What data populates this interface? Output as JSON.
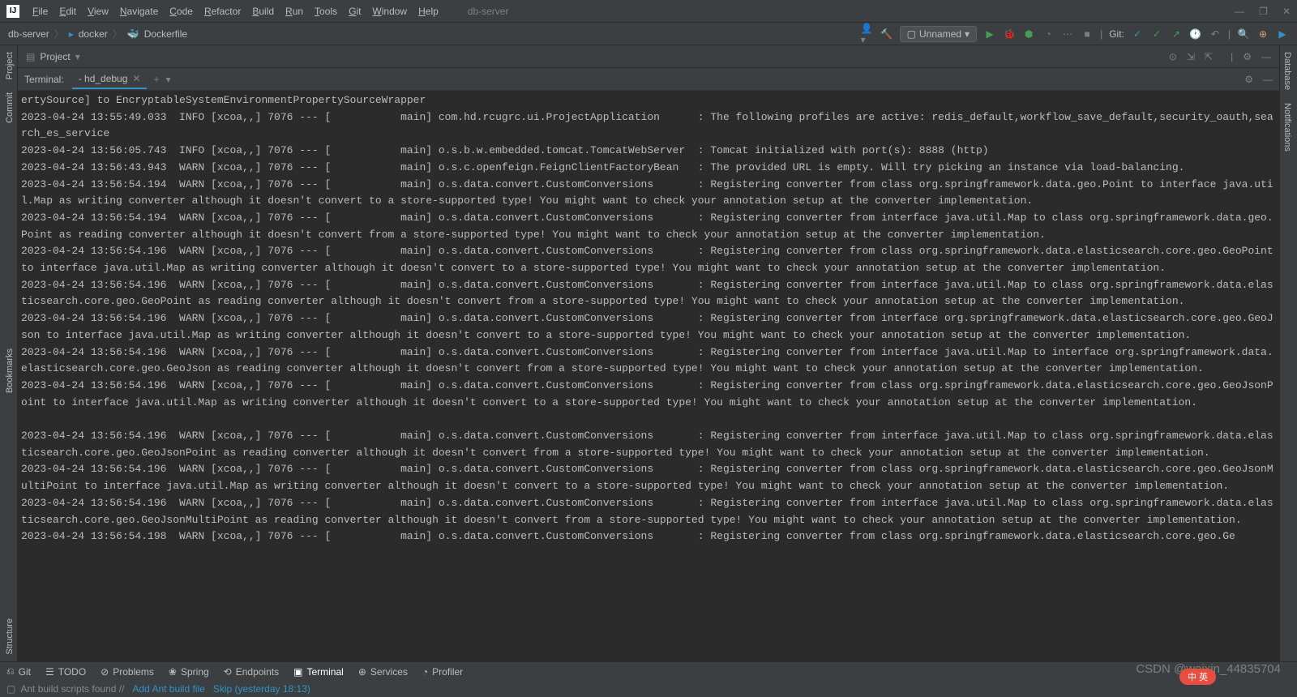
{
  "title_bar": {
    "project": "db-server"
  },
  "menus": [
    "File",
    "Edit",
    "View",
    "Navigate",
    "Code",
    "Refactor",
    "Build",
    "Run",
    "Tools",
    "Git",
    "Window",
    "Help"
  ],
  "breadcrumb": {
    "root": "db-server",
    "mid": "docker",
    "file": "Dockerfile"
  },
  "run_config": {
    "label": "Unnamed"
  },
  "git_label": "Git:",
  "project_panel": {
    "label": "Project"
  },
  "left_tabs": [
    "Project",
    "Commit",
    "Bookmarks",
    "Structure"
  ],
  "right_tabs": [
    "Database",
    "Notifications"
  ],
  "terminal": {
    "label": "Terminal:",
    "tab": "- hd_debug",
    "lines": [
      "ertySource] to EncryptableSystemEnvironmentPropertySourceWrapper",
      "2023-04-24 13:55:49.033  INFO [xcoa,,] 7076 --- [           main] com.hd.rcugrc.ui.ProjectApplication      : The following profiles are active: redis_default,workflow_save_default,security_oauth,search_es_service",
      "2023-04-24 13:56:05.743  INFO [xcoa,,] 7076 --- [           main] o.s.b.w.embedded.tomcat.TomcatWebServer  : Tomcat initialized with port(s): 8888 (http)",
      "2023-04-24 13:56:43.943  WARN [xcoa,,] 7076 --- [           main] o.s.c.openfeign.FeignClientFactoryBean   : The provided URL is empty. Will try picking an instance via load-balancing.",
      "2023-04-24 13:56:54.194  WARN [xcoa,,] 7076 --- [           main] o.s.data.convert.CustomConversions       : Registering converter from class org.springframework.data.geo.Point to interface java.util.Map as writing converter although it doesn't convert to a store-supported type! You might want to check your annotation setup at the converter implementation.",
      "2023-04-24 13:56:54.194  WARN [xcoa,,] 7076 --- [           main] o.s.data.convert.CustomConversions       : Registering converter from interface java.util.Map to class org.springframework.data.geo.Point as reading converter although it doesn't convert from a store-supported type! You might want to check your annotation setup at the converter implementation.",
      "2023-04-24 13:56:54.196  WARN [xcoa,,] 7076 --- [           main] o.s.data.convert.CustomConversions       : Registering converter from class org.springframework.data.elasticsearch.core.geo.GeoPoint to interface java.util.Map as writing converter although it doesn't convert to a store-supported type! You might want to check your annotation setup at the converter implementation.",
      "2023-04-24 13:56:54.196  WARN [xcoa,,] 7076 --- [           main] o.s.data.convert.CustomConversions       : Registering converter from interface java.util.Map to class org.springframework.data.elasticsearch.core.geo.GeoPoint as reading converter although it doesn't convert from a store-supported type! You might want to check your annotation setup at the converter implementation.",
      "2023-04-24 13:56:54.196  WARN [xcoa,,] 7076 --- [           main] o.s.data.convert.CustomConversions       : Registering converter from interface org.springframework.data.elasticsearch.core.geo.GeoJson to interface java.util.Map as writing converter although it doesn't convert to a store-supported type! You might want to check your annotation setup at the converter implementation.",
      "2023-04-24 13:56:54.196  WARN [xcoa,,] 7076 --- [           main] o.s.data.convert.CustomConversions       : Registering converter from interface java.util.Map to interface org.springframework.data.elasticsearch.core.geo.GeoJson as reading converter although it doesn't convert from a store-supported type! You might want to check your annotation setup at the converter implementation.",
      "2023-04-24 13:56:54.196  WARN [xcoa,,] 7076 --- [           main] o.s.data.convert.CustomConversions       : Registering converter from class org.springframework.data.elasticsearch.core.geo.GeoJsonPoint to interface java.util.Map as writing converter although it doesn't convert to a store-supported type! You might want to check your annotation setup at the converter implementation.",
      "",
      "2023-04-24 13:56:54.196  WARN [xcoa,,] 7076 --- [           main] o.s.data.convert.CustomConversions       : Registering converter from interface java.util.Map to class org.springframework.data.elasticsearch.core.geo.GeoJsonPoint as reading converter although it doesn't convert from a store-supported type! You might want to check your annotation setup at the converter implementation.",
      "2023-04-24 13:56:54.196  WARN [xcoa,,] 7076 --- [           main] o.s.data.convert.CustomConversions       : Registering converter from class org.springframework.data.elasticsearch.core.geo.GeoJsonMultiPoint to interface java.util.Map as writing converter although it doesn't convert to a store-supported type! You might want to check your annotation setup at the converter implementation.",
      "2023-04-24 13:56:54.196  WARN [xcoa,,] 7076 --- [           main] o.s.data.convert.CustomConversions       : Registering converter from interface java.util.Map to class org.springframework.data.elasticsearch.core.geo.GeoJsonMultiPoint as reading converter although it doesn't convert from a store-supported type! You might want to check your annotation setup at the converter implementation.",
      "2023-04-24 13:56:54.198  WARN [xcoa,,] 7076 --- [           main] o.s.data.convert.CustomConversions       : Registering converter from class org.springframework.data.elasticsearch.core.geo.Ge"
    ]
  },
  "bottom_tabs": [
    {
      "icon": "⎌",
      "label": "Git"
    },
    {
      "icon": "☰",
      "label": "TODO"
    },
    {
      "icon": "⊘",
      "label": "Problems"
    },
    {
      "icon": "❀",
      "label": "Spring"
    },
    {
      "icon": "⟲",
      "label": "Endpoints"
    },
    {
      "icon": "▣",
      "label": "Terminal"
    },
    {
      "icon": "⊕",
      "label": "Services"
    },
    {
      "icon": "◔",
      "label": "Profiler"
    }
  ],
  "status": {
    "msg": "Ant build scripts found //",
    "link1": "Add Ant build file",
    "link2": "Skip (yesterday 18:13)"
  },
  "watermark": "CSDN @weixin_44835704",
  "ime": "中 英"
}
